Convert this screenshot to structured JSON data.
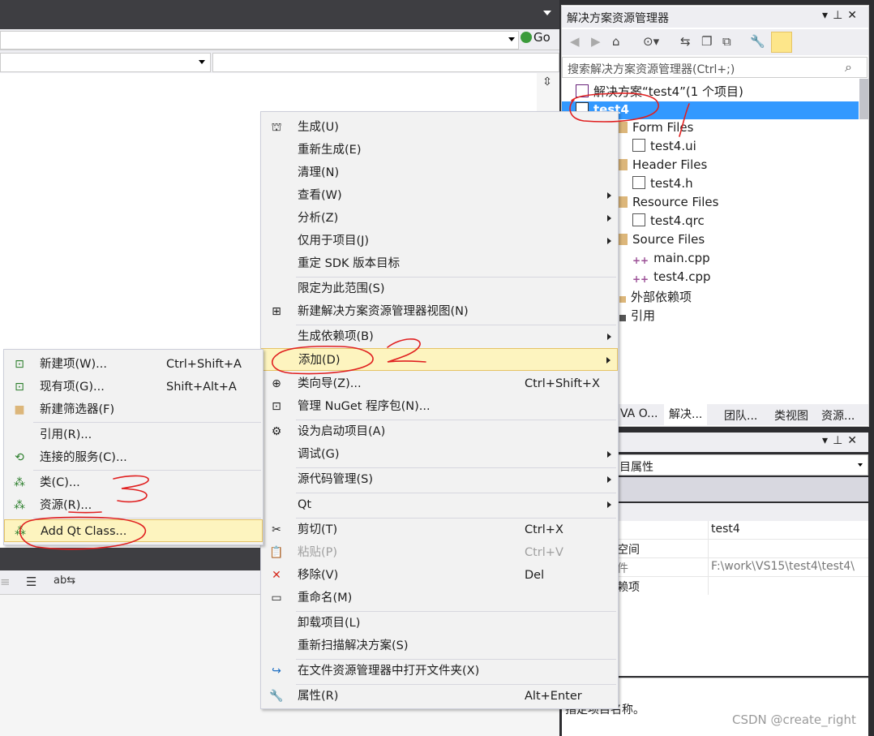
{
  "editor": {
    "go_label": "Go"
  },
  "solution_explorer": {
    "title": "解决方案资源管理器",
    "search_placeholder": "搜索解决方案资源管理器(Ctrl+;)",
    "tree": [
      {
        "label": "解决方案“test4”(1 个项目)",
        "icon": "solution-icon"
      },
      {
        "label": "test4",
        "icon": "project-icon",
        "selected": true
      },
      {
        "label": "Form Files",
        "icon": "folder-icon"
      },
      {
        "label": "test4.ui",
        "icon": "file-icon"
      },
      {
        "label": "Header Files",
        "icon": "folder-icon"
      },
      {
        "label": "test4.h",
        "icon": "header-file-icon"
      },
      {
        "label": "Resource Files",
        "icon": "folder-icon"
      },
      {
        "label": "test4.qrc",
        "icon": "file-icon"
      },
      {
        "label": "Source Files",
        "icon": "folder-icon"
      },
      {
        "label": "main.cpp",
        "icon": "cpp-file-icon"
      },
      {
        "label": "test4.cpp",
        "icon": "cpp-file-icon"
      },
      {
        "label": "外部依赖项",
        "icon": "dependencies-icon"
      },
      {
        "label": "引用",
        "icon": "references-icon"
      }
    ],
    "tabs": [
      "VA O...",
      "解决...",
      "团队...",
      "类视图",
      "资源..."
    ]
  },
  "properties": {
    "combo_label": "目属性",
    "rows": [
      {
        "key": "",
        "value": "test4"
      },
      {
        "key": "空间",
        "value": ""
      },
      {
        "key": "件",
        "value": "F:\\work\\VS15\\test4\\test4\\"
      },
      {
        "key": "赖项",
        "value": ""
      }
    ],
    "description": "指定项目名称。"
  },
  "context_menu": {
    "items": [
      {
        "label": "生成(U)",
        "shortcut": "",
        "submenu": false,
        "icon": "build-icon"
      },
      {
        "label": "重新生成(E)",
        "shortcut": "",
        "submenu": false
      },
      {
        "label": "清理(N)",
        "shortcut": "",
        "submenu": false
      },
      {
        "label": "查看(W)",
        "shortcut": "",
        "submenu": true
      },
      {
        "label": "分析(Z)",
        "shortcut": "",
        "submenu": true
      },
      {
        "label": "仅用于项目(J)",
        "shortcut": "",
        "submenu": true
      },
      {
        "label": "重定 SDK 版本目标",
        "shortcut": "",
        "submenu": false
      },
      {
        "label": "限定为此范围(S)",
        "shortcut": "",
        "submenu": false
      },
      {
        "label": "新建解决方案资源管理器视图(N)",
        "shortcut": "",
        "submenu": false,
        "icon": "new-view-icon"
      },
      {
        "label": "生成依赖项(B)",
        "shortcut": "",
        "submenu": true
      },
      {
        "label": "添加(D)",
        "shortcut": "",
        "submenu": true,
        "highlighted": true
      },
      {
        "label": "类向导(Z)...",
        "shortcut": "Ctrl+Shift+X",
        "submenu": false,
        "icon": "class-wizard-icon"
      },
      {
        "label": "管理 NuGet 程序包(N)...",
        "shortcut": "",
        "submenu": false,
        "icon": "nuget-icon"
      },
      {
        "label": "设为启动项目(A)",
        "shortcut": "",
        "submenu": false,
        "icon": "gear-icon"
      },
      {
        "label": "调试(G)",
        "shortcut": "",
        "submenu": true
      },
      {
        "label": "源代码管理(S)",
        "shortcut": "",
        "submenu": true
      },
      {
        "label": "Qt",
        "shortcut": "",
        "submenu": true
      },
      {
        "label": "剪切(T)",
        "shortcut": "Ctrl+X",
        "submenu": false,
        "icon": "scissors-icon"
      },
      {
        "label": "粘贴(P)",
        "shortcut": "Ctrl+V",
        "submenu": false,
        "disabled": true,
        "icon": "paste-icon"
      },
      {
        "label": "移除(V)",
        "shortcut": "Del",
        "submenu": false,
        "icon": "remove-x-icon"
      },
      {
        "label": "重命名(M)",
        "shortcut": "",
        "submenu": false,
        "icon": "rename-icon"
      },
      {
        "label": "卸载项目(L)",
        "shortcut": "",
        "submenu": false
      },
      {
        "label": "重新扫描解决方案(S)",
        "shortcut": "",
        "submenu": false
      },
      {
        "label": "在文件资源管理器中打开文件夹(X)",
        "shortcut": "",
        "submenu": false,
        "icon": "open-folder-arrow-icon"
      },
      {
        "label": "属性(R)",
        "shortcut": "Alt+Enter",
        "submenu": false,
        "icon": "wrench-icon"
      }
    ]
  },
  "add_submenu": {
    "items": [
      {
        "label": "新建项(W)...",
        "shortcut": "Ctrl+Shift+A",
        "icon": "new-item-icon"
      },
      {
        "label": "现有项(G)...",
        "shortcut": "Shift+Alt+A",
        "icon": "existing-item-icon"
      },
      {
        "label": "新建筛选器(F)",
        "shortcut": "",
        "icon": "new-filter-icon"
      },
      {
        "label": "引用(R)...",
        "shortcut": ""
      },
      {
        "label": "连接的服务(C)...",
        "shortcut": "",
        "icon": "connected-service-icon"
      },
      {
        "label": "类(C)...",
        "shortcut": "",
        "icon": "class-icon"
      },
      {
        "label": "资源(R)...",
        "shortcut": "",
        "icon": "resource-icon"
      },
      {
        "label": "Add Qt Class...",
        "shortcut": "",
        "highlighted": true,
        "icon": "qt-class-icon"
      }
    ]
  },
  "watermark": "CSDN @create_right",
  "annotation_color": "#e02020"
}
